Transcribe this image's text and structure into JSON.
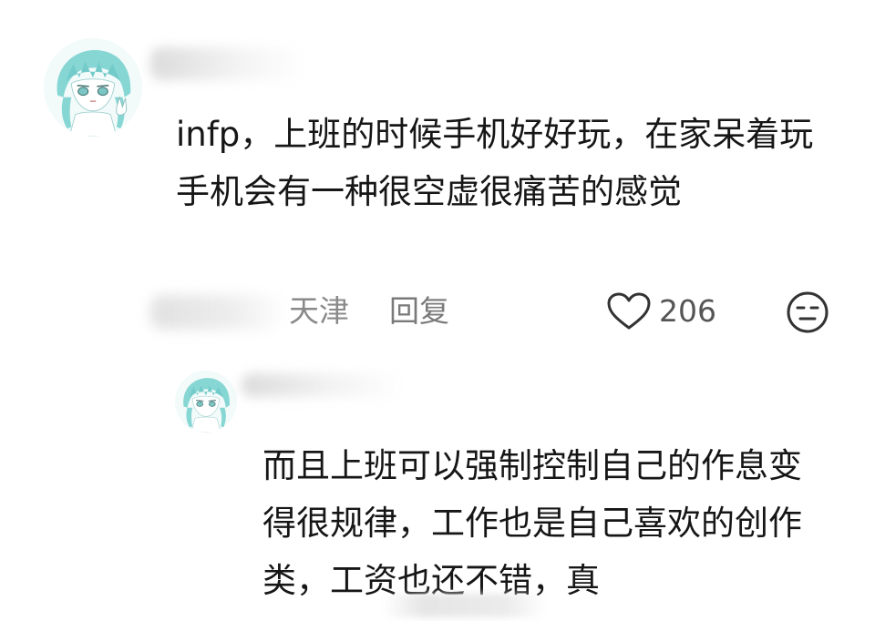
{
  "comment": {
    "text": "infp，上班的时候手机好好玩，在家呆着玩手机会有一种很空虚很痛苦的感觉",
    "location": "天津",
    "reply_label": "回复",
    "like_count": "206",
    "avatar_icon": "anime-avatar-icon",
    "like_icon": "heart-outline-icon",
    "emoji_icon": "neutral-face-icon"
  },
  "reply": {
    "text": "而且上班可以强制控制自己的作息变得很规律，工作也是自己喜欢的创作类，工资也还不错，真",
    "avatar_icon": "anime-avatar-icon"
  },
  "colors": {
    "avatar_hair": "#7fd3d3",
    "text": "#161616",
    "meta": "#8a8a8a"
  }
}
